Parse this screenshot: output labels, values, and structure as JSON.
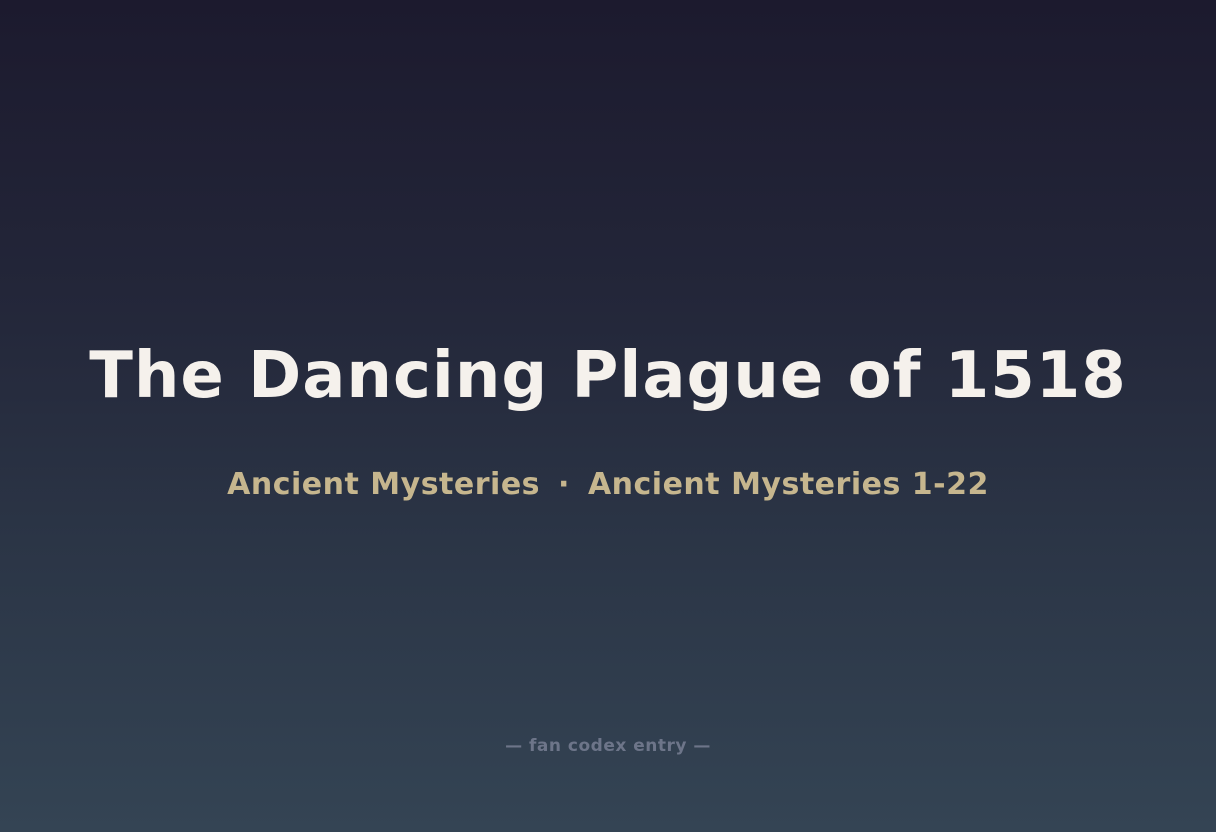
{
  "title": "The Dancing Plague of 1518",
  "subtitle": {
    "category": "Ancient Mysteries",
    "separator": "·",
    "series": "Ancient Mysteries 1-22"
  },
  "footer": "— fan codex entry —",
  "colors": {
    "title": "#f5f1ec",
    "subtitle": "#c6b68e",
    "footer": "#6d7589",
    "background_top": "#1c1a2e",
    "background_bottom": "#344454"
  }
}
